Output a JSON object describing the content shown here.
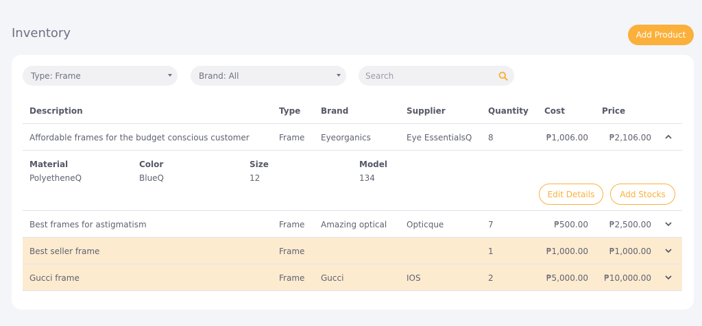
{
  "header": {
    "title": "Inventory",
    "add_product_label": "Add Product"
  },
  "filters": {
    "type_label": "Type: Frame",
    "brand_label": "Brand: All",
    "search_placeholder": "Search"
  },
  "table": {
    "columns": [
      "Description",
      "Type",
      "Brand",
      "Supplier",
      "Quantity",
      "Cost",
      "Price"
    ],
    "rows": [
      {
        "description": "Affordable frames for the budget conscious customer",
        "type": "Frame",
        "brand": "Eyeorganics",
        "supplier": "Eye EssentialsQ",
        "quantity": "8",
        "cost": "₱1,006.00",
        "price": "₱2,106.00",
        "expanded": true
      },
      {
        "description": "Best frames for astigmatism",
        "type": "Frame",
        "brand": "Amazing optical",
        "supplier": "Opticque",
        "quantity": "7",
        "cost": "₱500.00",
        "price": "₱2,500.00",
        "expanded": false
      },
      {
        "description": "Best seller frame",
        "type": "Frame",
        "brand": "",
        "supplier": "",
        "quantity": "1",
        "cost": "₱1,000.00",
        "price": "₱1,000.00",
        "expanded": false,
        "highlight": true
      },
      {
        "description": "Gucci frame",
        "type": "Frame",
        "brand": "Gucci",
        "supplier": "IOS",
        "quantity": "2",
        "cost": "₱5,000.00",
        "price": "₱10,000.00",
        "expanded": false,
        "highlight": true
      }
    ]
  },
  "detail": {
    "material_label": "Material",
    "material_value": "PolyetheneQ",
    "color_label": "Color",
    "color_value": "BlueQ",
    "size_label": "Size",
    "size_value": "12",
    "model_label": "Model",
    "model_value": "134",
    "edit_label": "Edit Details",
    "stock_label": "Add Stocks"
  },
  "colors": {
    "accent": "#fbb03b",
    "highlight_row": "#fdebd0",
    "background": "#f4f5f9"
  },
  "icons": {
    "search": "search-icon",
    "expand": "chevron-down-icon",
    "collapse": "chevron-up-icon"
  }
}
